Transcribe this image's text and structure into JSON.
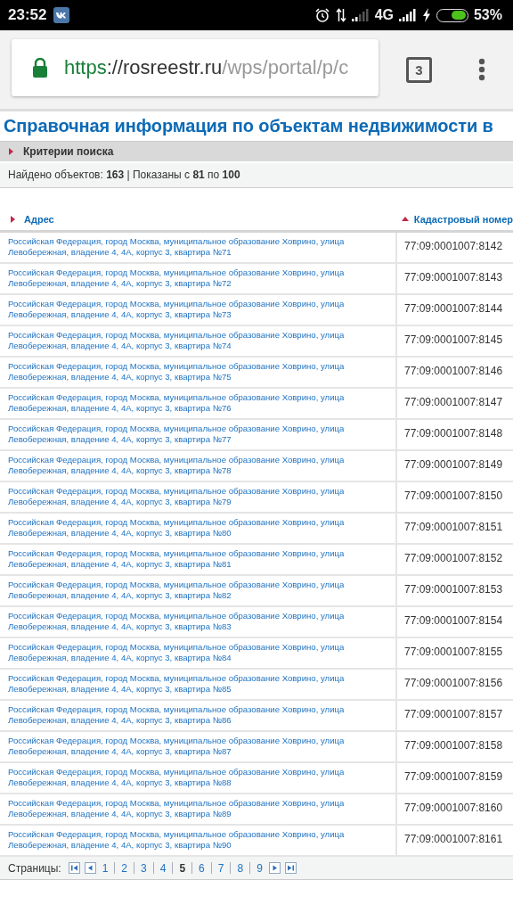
{
  "status_bar": {
    "time": "23:52",
    "network": "4G",
    "battery": {
      "reading": "53%",
      "level": 0.53
    }
  },
  "browser": {
    "url": {
      "scheme": "https",
      "host": "://rosreestr.ru",
      "path": "/wps/portal/p/c"
    },
    "tab_count": "3"
  },
  "page": {
    "title": "Справочная информация по объектам недвижимости в",
    "criteria": {
      "label": "Критерии поиска"
    },
    "summary": "Найдено объектов: **163** | Показаны с **81** по **100**",
    "table": {
      "columns": [
        {
          "label": "Адрес",
          "kind": "unsorted"
        },
        {
          "label": "Кадастровый номер",
          "kind": "ascending"
        }
      ],
      "rows": [
        {
          "address": "Российская Федерация, город Москва, муниципальное образование Ховрино, улица Левобережная, владение 4, 4А, корпус 3, квартира №71",
          "number": "77:09:0001007:8142"
        },
        {
          "address": "Российская Федерация, город Москва, муниципальное образование Ховрино, улица Левобережная, владение 4, 4А, корпус 3, квартира №72",
          "number": "77:09:0001007:8143"
        },
        {
          "address": "Российская Федерация, город Москва, муниципальное образование Ховрино, улица Левобережная, владение 4, 4А, корпус 3, квартира №73",
          "number": "77:09:0001007:8144"
        },
        {
          "address": "Российская Федерация, город Москва, муниципальное образование Ховрино, улица Левобережная, владение 4, 4А, корпус 3, квартира №74",
          "number": "77:09:0001007:8145"
        },
        {
          "address": "Российская Федерация, город Москва, муниципальное образование Ховрино, улица Левобережная, владение 4, 4А, корпус 3, квартира №75",
          "number": "77:09:0001007:8146"
        },
        {
          "address": "Российская Федерация, город Москва, муниципальное образование Ховрино, улица Левобережная, владение 4, 4А, корпус 3, квартира №76",
          "number": "77:09:0001007:8147"
        },
        {
          "address": "Российская Федерация, город Москва, муниципальное образование Ховрино, улица Левобережная, владение 4, 4А, корпус 3, квартира №77",
          "number": "77:09:0001007:8148"
        },
        {
          "address": "Российская Федерация, город Москва, муниципальное образование Ховрино, улица Левобережная, владение 4, 4А, корпус 3, квартира №78",
          "number": "77:09:0001007:8149"
        },
        {
          "address": "Российская Федерация, город Москва, муниципальное образование Ховрино, улица Левобережная, владение 4, 4А, корпус 3, квартира №79",
          "number": "77:09:0001007:8150"
        },
        {
          "address": "Российская Федерация, город Москва, муниципальное образование Ховрино, улица Левобережная, владение 4, 4А, корпус 3, квартира №80",
          "number": "77:09:0001007:8151"
        },
        {
          "address": "Российская Федерация, город Москва, муниципальное образование Ховрино, улица Левобережная, владение 4, 4А, корпус 3, квартира №81",
          "number": "77:09:0001007:8152"
        },
        {
          "address": "Российская Федерация, город Москва, муниципальное образование Ховрино, улица Левобережная, владение 4, 4А, корпус 3, квартира №82",
          "number": "77:09:0001007:8153"
        },
        {
          "address": "Российская Федерация, город Москва, муниципальное образование Ховрино, улица Левобережная, владение 4, 4А, корпус 3, квартира №83",
          "number": "77:09:0001007:8154"
        },
        {
          "address": "Российская Федерация, город Москва, муниципальное образование Ховрино, улица Левобережная, владение 4, 4А, корпус 3, квартира №84",
          "number": "77:09:0001007:8155"
        },
        {
          "address": "Российская Федерация, город Москва, муниципальное образование Ховрино, улица Левобережная, владение 4, 4А, корпус 3, квартира №85",
          "number": "77:09:0001007:8156"
        },
        {
          "address": "Российская Федерация, город Москва, муниципальное образование Ховрино, улица Левобережная, владение 4, 4А, корпус 3, квартира №86",
          "number": "77:09:0001007:8157"
        },
        {
          "address": "Российская Федерация, город Москва, муниципальное образование Ховрино, улица Левобережная, владение 4, 4А, корпус 3, квартира №87",
          "number": "77:09:0001007:8158"
        },
        {
          "address": "Российская Федерация, город Москва, муниципальное образование Ховрино, улица Левобережная, владение 4, 4А, корпус 3, квартира №88",
          "number": "77:09:0001007:8159"
        },
        {
          "address": "Российская Федерация, город Москва, муниципальное образование Ховрино, улица Левобережная, владение 4, 4А, корпус 3, квартира №89",
          "number": "77:09:0001007:8160"
        },
        {
          "address": "Российская Федерация, город Москва, муниципальное образование Ховрино, улица Левобережная, владение 4, 4А, корпус 3, квартира №90",
          "number": "77:09:0001007:8161"
        }
      ]
    },
    "pagination": {
      "label": "Страницы:",
      "pages": [
        {
          "label": "1",
          "selected": false
        },
        {
          "label": "2",
          "selected": false
        },
        {
          "label": "3",
          "selected": false
        },
        {
          "label": "4",
          "selected": false
        },
        {
          "label": "5",
          "selected": true
        },
        {
          "label": "6",
          "selected": false
        },
        {
          "label": "7",
          "selected": false
        },
        {
          "label": "8",
          "selected": false
        },
        {
          "label": "9",
          "selected": false
        }
      ]
    }
  }
}
